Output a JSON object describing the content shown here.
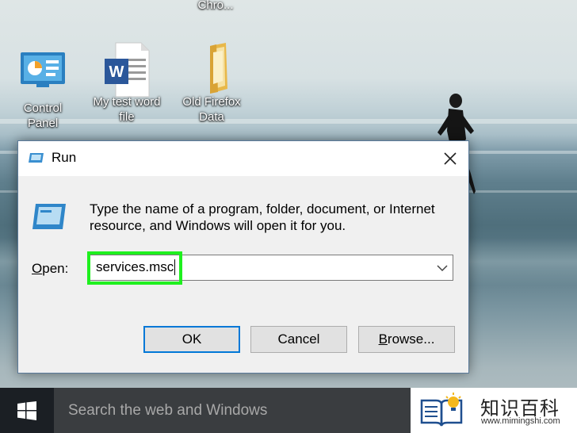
{
  "desktop": {
    "top_label": "Chro...",
    "icons": [
      {
        "label_line1": "Control",
        "label_line2": "Panel",
        "icon": "control-panel-icon"
      },
      {
        "label_line1": "My test word",
        "label_line2": "file",
        "icon": "word-document-icon"
      },
      {
        "label_line1": "Old Firefox",
        "label_line2": "Data",
        "icon": "folder-icon"
      }
    ]
  },
  "run_dialog": {
    "title": "Run",
    "description": "Type the name of a program, folder, document, or Internet resource, and Windows will open it for you.",
    "open_label": "Open:",
    "input_value": "services.msc",
    "buttons": {
      "ok": "OK",
      "cancel": "Cancel",
      "browse": "Browse..."
    },
    "highlight_color": "#1ff01f"
  },
  "taskbar": {
    "search_placeholder": "Search the web and Windows"
  },
  "watermark": {
    "title": "知识百科",
    "url": "www.mimingshi.com"
  }
}
